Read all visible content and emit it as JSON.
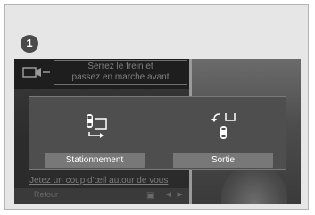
{
  "step_number": "1",
  "background": {
    "camera_icon": "camera-mode-icon",
    "message_line1": "Serrez le frein et",
    "message_line2": "passez en marche avant",
    "bottom_text": "Jetez un coup d'œil autour de vous",
    "bottom_button": "Retour",
    "car_icon": "car-icon",
    "arrows": "◄ ►"
  },
  "popup": {
    "options": [
      {
        "label": "Stationnement",
        "icon": "parking-in-icon"
      },
      {
        "label": "Sortie",
        "icon": "parking-exit-icon"
      }
    ]
  }
}
